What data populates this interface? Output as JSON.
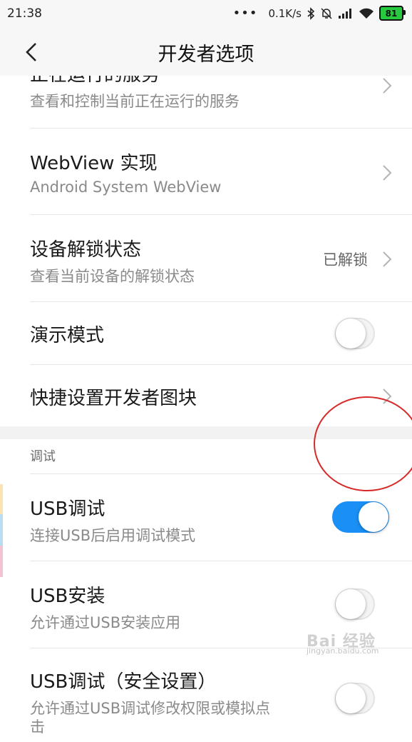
{
  "status": {
    "time": "21:38",
    "dots": "•••",
    "speed": "0.1K/s",
    "battery": "81"
  },
  "header": {
    "title": "开发者选项"
  },
  "rows": {
    "running_services": {
      "title": "正在运行的服务",
      "subtitle": "查看和控制当前正在运行的服务"
    },
    "webview": {
      "title": "WebView 实现",
      "subtitle": "Android System WebView"
    },
    "unlock_status": {
      "title": "设备解锁状态",
      "subtitle": "查看当前设备的解锁状态",
      "value": "已解锁"
    },
    "demo_mode": {
      "title": "演示模式",
      "enabled": false
    },
    "quick_tiles": {
      "title": "快捷设置开发者图块"
    }
  },
  "debug_section": {
    "header": "调试",
    "usb_debug": {
      "title": "USB调试",
      "subtitle": "连接USB后启用调试模式",
      "enabled": true
    },
    "usb_install": {
      "title": "USB安装",
      "subtitle": "允许通过USB安装应用",
      "enabled": false
    },
    "usb_debug_secure": {
      "title": "USB调试（安全设置）",
      "subtitle_line1": "允许通过USB调试修改权限或模拟点",
      "subtitle_line2": "击",
      "enabled": false
    }
  },
  "watermark": {
    "brand": "Bai 经验",
    "url": "jingyan.baidu.com"
  },
  "colors": {
    "toggle_on": "#1a8ff5",
    "annotation_circle": "#d62a2a"
  }
}
